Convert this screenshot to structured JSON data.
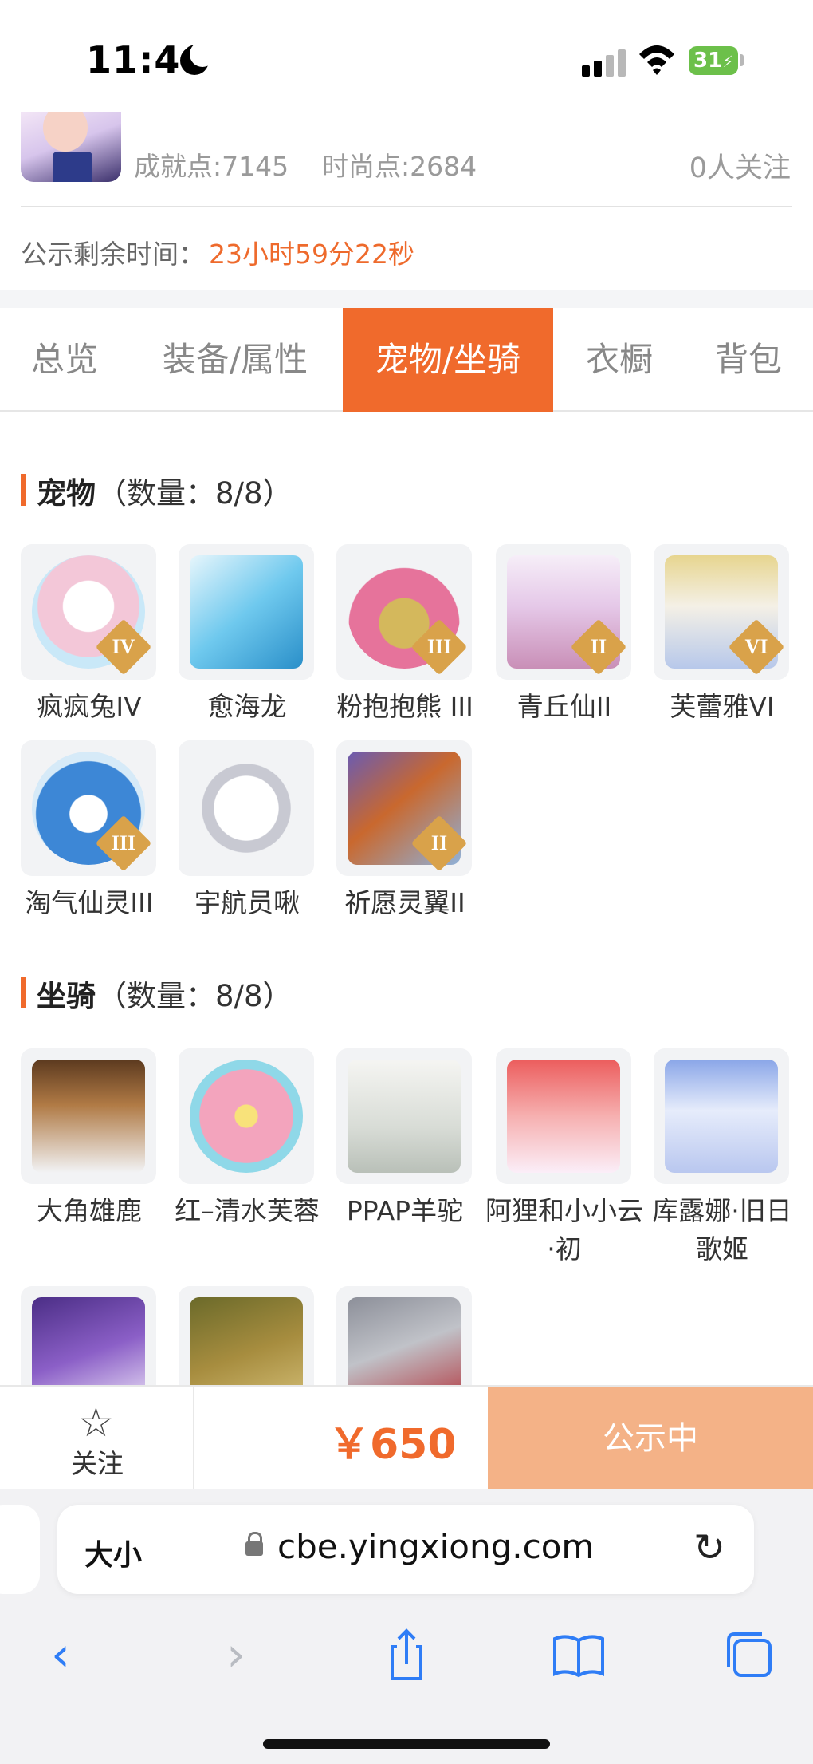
{
  "status_bar": {
    "time": "11:46",
    "battery": "31"
  },
  "item_header": {
    "achievement": "成就点:7145",
    "fashion": "时尚点:2684",
    "followers": "0人关注",
    "notice_label": "公示剩余时间：",
    "notice_time": "23小时59分22秒"
  },
  "tabs": [
    {
      "label": "总览",
      "active": false
    },
    {
      "label": "装备/属性",
      "active": false
    },
    {
      "label": "宠物/坐骑",
      "active": true
    },
    {
      "label": "衣橱",
      "active": false
    },
    {
      "label": "背包",
      "active": false
    }
  ],
  "pets": {
    "title": "宠物",
    "count": "（数量：8/8）",
    "items": [
      {
        "name": "疯疯兔IV",
        "rank": "IV",
        "icon": "bunny-pet-icon",
        "color": "#f3c7d8"
      },
      {
        "name": "愈海龙",
        "rank": "",
        "icon": "sea-dragon-pet-icon",
        "color": "#6fc9ee"
      },
      {
        "name": "粉抱抱熊 III",
        "rank": "III",
        "icon": "bear-pet-icon",
        "color": "#e6739b"
      },
      {
        "name": "青丘仙II",
        "rank": "II",
        "icon": "fox-fairy-pet-icon",
        "color": "#e5c8e8"
      },
      {
        "name": "芙蕾雅VI",
        "rank": "VI",
        "icon": "goddess-pet-icon",
        "color": "#e7d58f"
      },
      {
        "name": "淘气仙灵III",
        "rank": "III",
        "icon": "blue-spirit-pet-icon",
        "color": "#3d87d6"
      },
      {
        "name": "宇航员啾",
        "rank": "",
        "icon": "astronaut-pet-icon",
        "color": "#e9e9ee"
      },
      {
        "name": "祈愿灵翼II",
        "rank": "II",
        "icon": "phoenix-pet-icon",
        "color": "#c9682e"
      }
    ]
  },
  "mounts": {
    "title": "坐骑",
    "count": "（数量：8/8）",
    "items": [
      {
        "name": "大角雄鹿",
        "icon": "stag-mount-icon",
        "color": "#b07a45"
      },
      {
        "name": "红–清水芙蓉",
        "icon": "lotus-mount-icon",
        "color": "#f3a4bd"
      },
      {
        "name": "PPAP羊驼",
        "icon": "alpaca-mount-icon",
        "color": "#d8dcd6"
      },
      {
        "name": "阿狸和小小云·初",
        "icon": "ali-fox-mount-icon",
        "color": "#ec5d5d"
      },
      {
        "name": "库露娜·旧日歌姬",
        "icon": "songstress-mount-icon",
        "color": "#b9c7ef"
      },
      {
        "name": "",
        "icon": "purple-dragon-mount-icon",
        "color": "#8b5fc7"
      },
      {
        "name": "",
        "icon": "gold-beetle-mount-icon",
        "color": "#a78d3f"
      },
      {
        "name": "",
        "icon": "silver-beetle-mount-icon",
        "color": "#c0c2c8"
      }
    ]
  },
  "action_bar": {
    "follow": "关注",
    "price": "￥650",
    "status": "公示中"
  },
  "browser": {
    "aa": "大小",
    "url": "cbe.yingxiong.com"
  },
  "colors": {
    "accent": "#f06a2c",
    "status_button": "#f4b287"
  }
}
